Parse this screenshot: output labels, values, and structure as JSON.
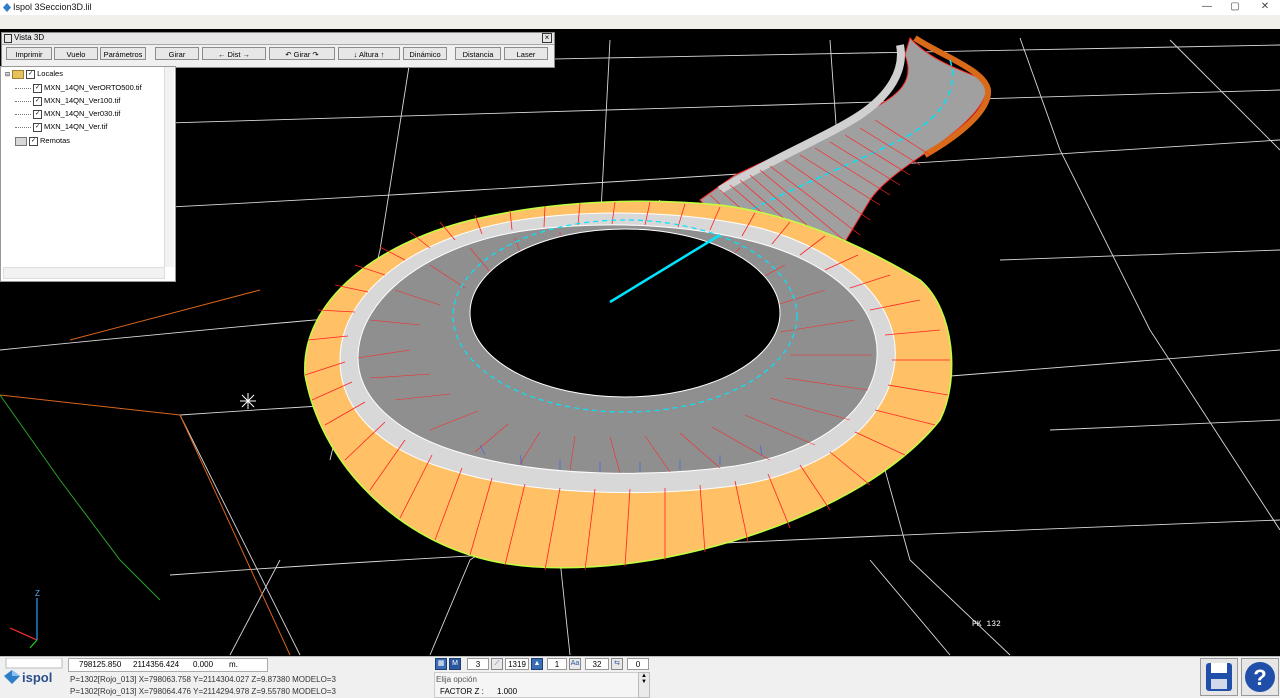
{
  "window": {
    "title": "Ispol  3Seccion3D.lil",
    "minimize": "—",
    "maximize": "▢",
    "close": "✕"
  },
  "vista3d": {
    "title": "Vista 3D",
    "buttons": [
      "Imprimir",
      "Vuelo",
      "Parámetros",
      "Girar",
      "←  Dist  →",
      "↶  Girar  ↷",
      "↓  Altura  ↑",
      "Dinámico",
      "Distancia",
      "Laser"
    ]
  },
  "tree": {
    "root_label": "Locales",
    "files": [
      "MXN_14QN_VerORTO500.tif",
      "MXN_14QN_Ver100.tif",
      "MXN_14QN_Ver030.tif",
      "MXN_14QN_Ver.tif"
    ],
    "remote_label": "Remotas"
  },
  "viewport": {
    "axis_label": "Z",
    "station_label": "PK 132"
  },
  "status": {
    "logo_text": "ispol",
    "coord_x": "798125.850",
    "coord_y": "2114356.424",
    "coord_z": "0.000",
    "coord_unit": "m.",
    "line1": "P=1302[Rojo_013] X=798063.758 Y=2114304.027 Z=9.87380 MODELO=3",
    "line2": "P=1302[Rojo_013] X=798064.476 Y=2114294.978 Z=9.55780 MODELO=3",
    "tool_m": "M",
    "val1": "3",
    "val2": "1319",
    "val3": "1",
    "val4": "32",
    "val5": "0",
    "option_prompt": "Elija opción",
    "factor_label": "FACTOR Z :",
    "factor_value": "1.000"
  },
  "colors": {
    "background": "#000000",
    "grid": "#ffffff",
    "slope_fill": "#ffc066",
    "lane_fill": "#8f8f8f",
    "section_lines": "#ff0000",
    "centerline": "#00e5ff"
  }
}
